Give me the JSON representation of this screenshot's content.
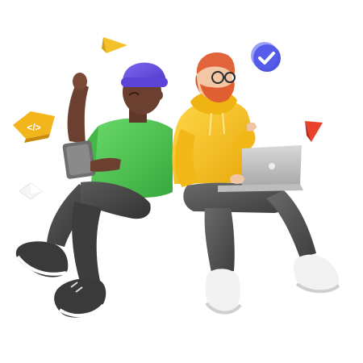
{
  "scene": {
    "background": "#ffffff",
    "floating_icons": {
      "code_badge": {
        "glyph": "</>",
        "icon": "code-icon",
        "color": "#f2b51c"
      },
      "check_badge": {
        "icon": "check-icon",
        "color": "#4f55e0"
      },
      "triangles": [
        {
          "icon": "yellow-triangle-icon",
          "color": "#f4c12a"
        },
        {
          "icon": "red-triangle-icon",
          "color": "#e8422d"
        }
      ],
      "diamond": {
        "icon": "white-diamond-icon",
        "color": "#f1f1f1"
      }
    },
    "characters": [
      {
        "id": "left-person",
        "hat_color": "#6a52e0",
        "shirt_color": "#4fcb55",
        "skin_color": "#6b4030",
        "pants_color": "#4a4a4a",
        "shoe_color": "#3a3a3a",
        "device": "tablet"
      },
      {
        "id": "right-person",
        "hair_color": "#e2643a",
        "hoodie_color": "#f7c21b",
        "pants_color": "#555555",
        "shoe_color": "#f2f2f2",
        "device": "laptop"
      }
    ]
  }
}
